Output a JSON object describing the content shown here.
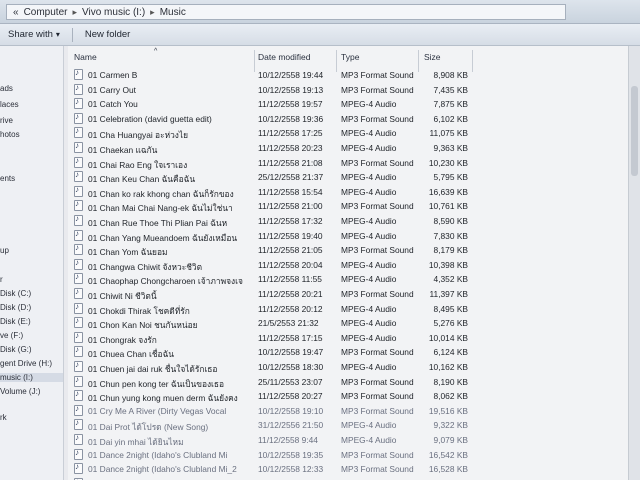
{
  "address": {
    "crumbs": [
      "Computer",
      "Vivo music (I:)",
      "Music"
    ]
  },
  "toolbar": {
    "share_with": "Share with",
    "share_arrow": "▾",
    "new_folder": "New folder"
  },
  "nav": {
    "items": [
      "ads",
      "laces",
      "rive",
      "hotos",
      "ents",
      "up",
      "r",
      "Disk (C:)",
      "Disk (D:)",
      "Disk (E:)",
      "ve (F:)",
      "Disk (G:)",
      "gent Drive (H:)",
      "music (I:)",
      "Volume (J:)",
      "rk"
    ]
  },
  "columns": {
    "name": "Name",
    "date": "Date modified",
    "type": "Type",
    "size": "Size"
  },
  "files": [
    {
      "name": "01 Carmen B",
      "date": "10/12/2558 19:44",
      "type": "MP3 Format Sound",
      "size": "8,908 KB"
    },
    {
      "name": "01 Carry Out",
      "date": "10/12/2558 19:13",
      "type": "MP3 Format Sound",
      "size": "7,435 KB"
    },
    {
      "name": "01 Catch You",
      "date": "11/12/2558 19:57",
      "type": "MPEG-4 Audio",
      "size": "7,875 KB"
    },
    {
      "name": "01 Celebration (david guetta edit)",
      "date": "10/12/2558 19:36",
      "type": "MP3 Format Sound",
      "size": "6,102 KB"
    },
    {
      "name": "01 Cha Huangyai อะห่วงไย",
      "date": "11/12/2558 17:25",
      "type": "MPEG-4 Audio",
      "size": "11,075 KB"
    },
    {
      "name": "01 Chaekan แฉกัน",
      "date": "11/12/2558 20:23",
      "type": "MPEG-4 Audio",
      "size": "9,363 KB"
    },
    {
      "name": "01 Chai Rao Eng ใจเราเอง",
      "date": "11/12/2558 21:08",
      "type": "MP3 Format Sound",
      "size": "10,230 KB"
    },
    {
      "name": "01 Chan Keu Chan ฉันคือฉัน",
      "date": "25/12/2558 21:37",
      "type": "MPEG-4 Audio",
      "size": "5,795 KB"
    },
    {
      "name": "01 Chan ko rak khong chan ฉันก็รักของ",
      "date": "11/12/2558 15:54",
      "type": "MPEG-4 Audio",
      "size": "16,639 KB"
    },
    {
      "name": "01 Chan Mai Chai Nang-ek ฉันไม่ใช่นา",
      "date": "11/12/2558 21:00",
      "type": "MP3 Format Sound",
      "size": "10,761 KB"
    },
    {
      "name": "01 Chan Rue Thoe Thi Plian Pai ฉันห",
      "date": "11/12/2558 17:32",
      "type": "MPEG-4 Audio",
      "size": "8,590 KB"
    },
    {
      "name": "01 Chan Yang Mueandoem ฉันยังเหมือน",
      "date": "11/12/2558 19:40",
      "type": "MPEG-4 Audio",
      "size": "7,830 KB"
    },
    {
      "name": "01 Chan Yom ฉันยอม",
      "date": "11/12/2558 21:05",
      "type": "MP3 Format Sound",
      "size": "8,179 KB"
    },
    {
      "name": "01 Changwa Chiwit จังหวะชีวิต",
      "date": "11/12/2558 20:04",
      "type": "MPEG-4 Audio",
      "size": "10,398 KB"
    },
    {
      "name": "01 Chaophap Chongcharoen เจ้าภาพจงเจ",
      "date": "11/12/2558 11:55",
      "type": "MPEG-4 Audio",
      "size": "4,352 KB"
    },
    {
      "name": "01 Chiwit Ni ชีวิตนี้",
      "date": "11/12/2558 20:21",
      "type": "MP3 Format Sound",
      "size": "11,397 KB"
    },
    {
      "name": "01 Chokdi Thirak โชคดีที่รัก",
      "date": "11/12/2558 20:12",
      "type": "MPEG-4 Audio",
      "size": "8,495 KB"
    },
    {
      "name": "01 Chon Kan Noi ชนกันหน่อย",
      "date": "21/5/2553 21:32",
      "type": "MPEG-4 Audio",
      "size": "5,276 KB"
    },
    {
      "name": "01 Chongrak จงรัก",
      "date": "11/12/2558 17:15",
      "type": "MPEG-4 Audio",
      "size": "10,014 KB"
    },
    {
      "name": "01 Chuea Chan เชื่อฉัน",
      "date": "10/12/2558 19:47",
      "type": "MP3 Format Sound",
      "size": "6,124 KB"
    },
    {
      "name": "01 Chuen jai dai ruk ชื่นใจได้รักเธอ",
      "date": "10/12/2558 18:30",
      "type": "MPEG-4 Audio",
      "size": "10,162 KB"
    },
    {
      "name": "01 Chun pen kong ter ฉันเป็นของเธอ",
      "date": "25/11/2553 23:07",
      "type": "MP3 Format Sound",
      "size": "8,190 KB"
    },
    {
      "name": "01 Chun yung kong muen derm ฉันยังคง",
      "date": "11/12/2558 20:27",
      "type": "MP3 Format Sound",
      "size": "8,062 KB"
    },
    {
      "name": "01 Cry Me A River (Dirty Vegas Vocal",
      "date": "10/12/2558 19:10",
      "type": "MP3 Format Sound",
      "size": "19,516 KB"
    },
    {
      "name": "01 Dai Prot ได้โปรด (New Song)",
      "date": "31/12/2556 21:50",
      "type": "MPEG-4 Audio",
      "size": "9,322 KB"
    },
    {
      "name": "01 Dai yin mhai ได้ยินไหม",
      "date": "11/12/2558 9:44",
      "type": "MPEG-4 Audio",
      "size": "9,079 KB"
    },
    {
      "name": "01 Dance 2night (Idaho's Clubland Mi",
      "date": "10/12/2558 19:35",
      "type": "MP3 Format Sound",
      "size": "16,542 KB"
    },
    {
      "name": "01 Dance 2night (Idaho's Clubland Mi_2",
      "date": "10/12/2558 12:33",
      "type": "MP3 Format Sound",
      "size": "16,528 KB"
    },
    {
      "name": "01 Dance 2Night (Idaho's Famous Suit",
      "date": "10/12/2558 19:35",
      "type": "MP3 Format Sound",
      "size": "12,558 KB"
    }
  ]
}
